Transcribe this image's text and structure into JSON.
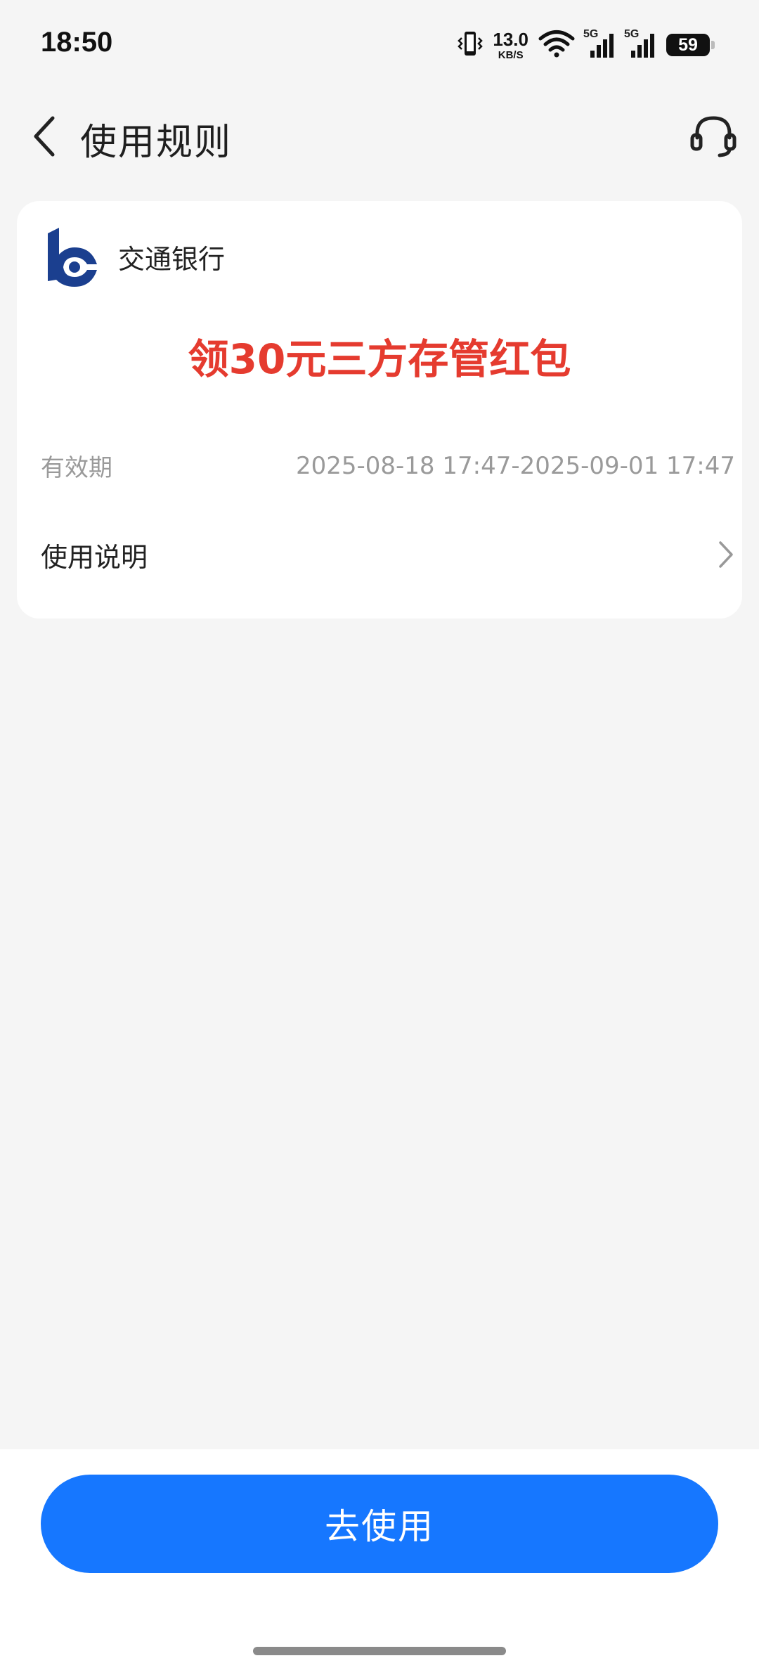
{
  "status_bar": {
    "time": "18:50",
    "net_speed_value": "13.0",
    "net_speed_unit": "KB/S",
    "sim1_tag": "5G",
    "sim2_tag": "5G",
    "battery": "59"
  },
  "header": {
    "title": "使用规则",
    "icons": [
      "back-arrow-icon",
      "customer-service-headset-icon"
    ]
  },
  "card": {
    "bank_name": "交通银行",
    "offer_title": "领30元三方存管红包",
    "validity_label": "有效期",
    "validity_value": "2025-08-18 17:47-2025-09-01 17:47",
    "instructions_label": "使用说明"
  },
  "footer": {
    "use_button_label": "去使用"
  },
  "colors": {
    "background": "#f5f5f5",
    "offer_red": "#e53b2f",
    "primary_blue": "#1677ff",
    "bank_logo_blue": "#1b3f8f"
  }
}
